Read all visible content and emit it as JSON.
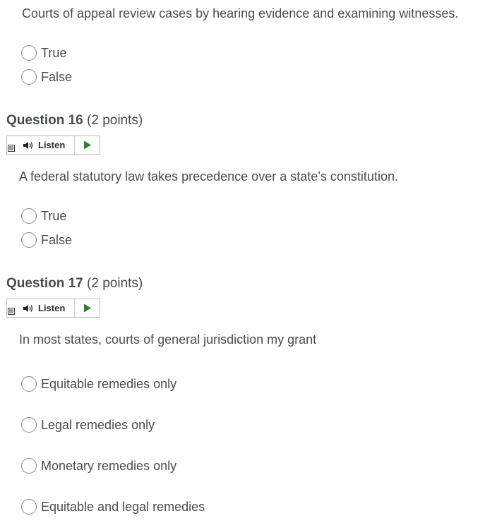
{
  "q15": {
    "text": "Courts of appeal review cases by hearing evidence and examining witnesses.",
    "options": [
      "True",
      "False"
    ]
  },
  "q16": {
    "header_num": "Question 16",
    "header_points": "(2 points)",
    "listen_label": "Listen",
    "text": "A federal statutory law takes precedence over a state’s constitution.",
    "options": [
      "True",
      "False"
    ]
  },
  "q17": {
    "header_num": "Question 17",
    "header_points": "(2 points)",
    "listen_label": "Listen",
    "text": "In most states, courts of general jurisdiction my grant",
    "options": [
      "Equitable remedies only",
      "Legal remedies only",
      "Monetary remedies only",
      "Equitable and legal remedies"
    ]
  },
  "icons": {
    "menu": "menu-icon",
    "speaker": "speaker-icon",
    "play": "play-icon"
  },
  "colors": {
    "text": "#494c4e",
    "radio_border": "#8a8c8e",
    "play": "#2e7d32"
  }
}
